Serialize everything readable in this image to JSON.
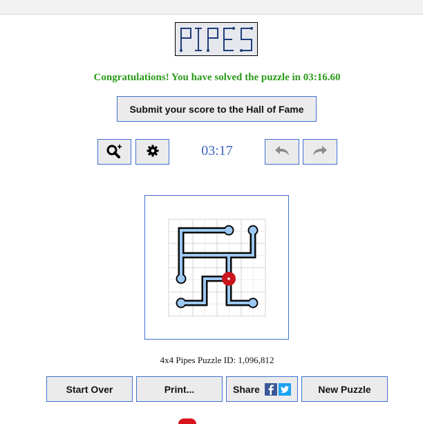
{
  "app": {
    "logo_text": "PIPES",
    "congrats": "Congratulations! You have solved the puzzle in 03:16.60",
    "submit_label": "Submit your score to the Hall of Fame",
    "timer": "03:17",
    "puzzle_id": "4x4 Pipes Puzzle ID: 1,096,812"
  },
  "buttons": {
    "start_over": "Start Over",
    "print": "Print...",
    "share": "Share",
    "new_puzzle": "New Puzzle"
  },
  "icons": {
    "zoom": "zoom-in-icon",
    "settings": "gear-icon",
    "undo": "undo-icon",
    "redo": "redo-icon",
    "facebook": "facebook-icon",
    "twitter": "twitter-icon"
  },
  "colors": {
    "congrats": "#2a9a1a",
    "timer": "#3b62c4",
    "button_border": "#3f6fcf",
    "pipe_fill": "#9cc8f2",
    "pipe_outline": "#0a0a0a",
    "source": "#c8141c",
    "facebook": "#3b5998",
    "twitter": "#1da1f2"
  },
  "grid": {
    "size": "4x4",
    "source_cell": [
      2,
      2
    ]
  }
}
